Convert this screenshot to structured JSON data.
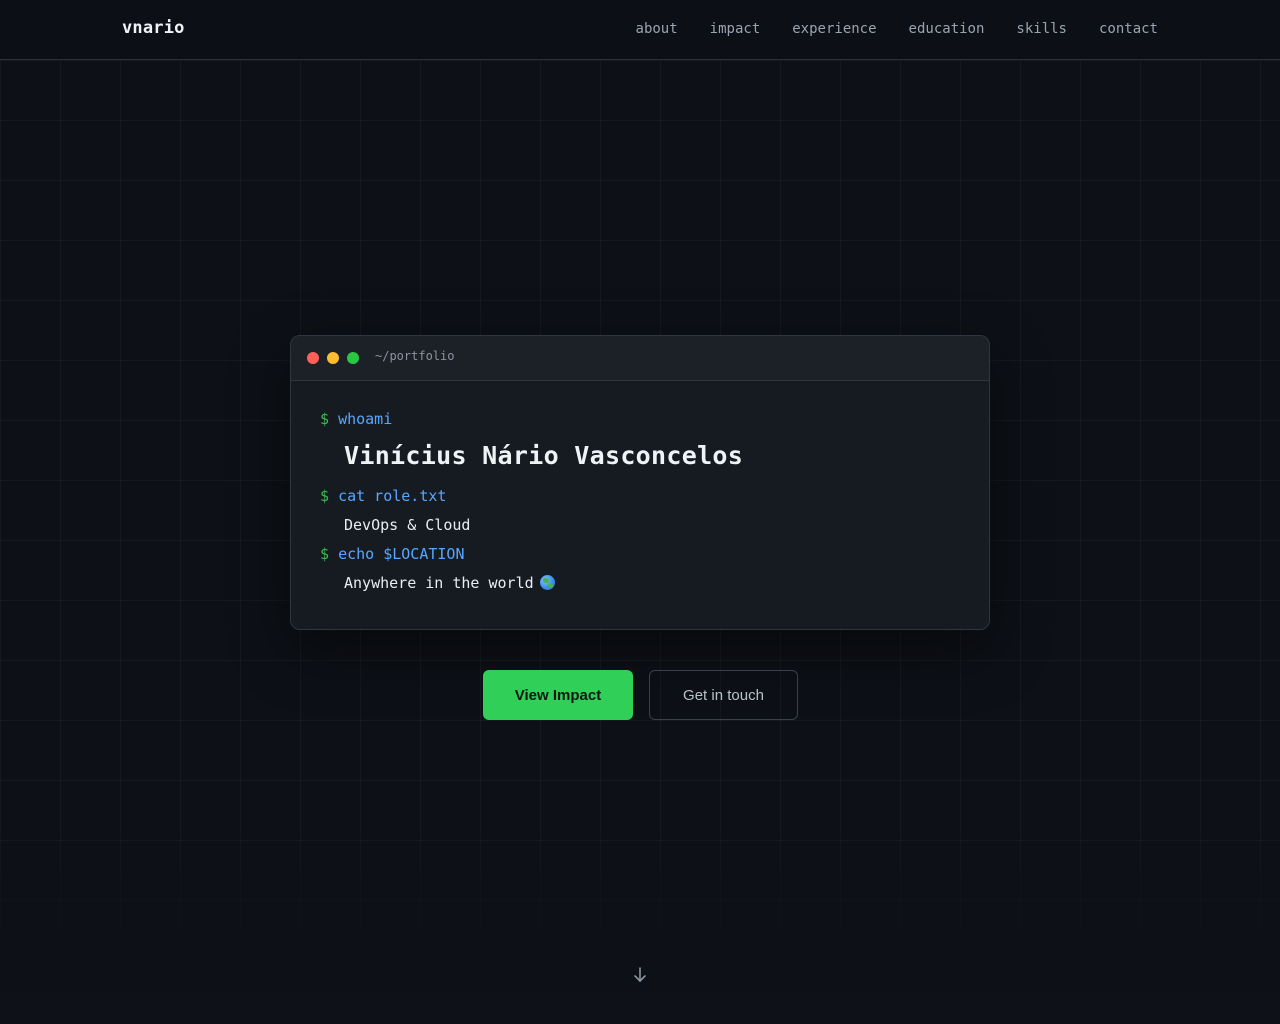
{
  "nav": {
    "brand": "vnario",
    "links": [
      {
        "label": "about"
      },
      {
        "label": "impact"
      },
      {
        "label": "experience"
      },
      {
        "label": "education"
      },
      {
        "label": "skills"
      },
      {
        "label": "contact"
      }
    ]
  },
  "terminal": {
    "path": "~/portfolio",
    "prompt": "$",
    "lines": [
      {
        "cmd": "whoami",
        "output": "Vinícius Nário Vasconcelos"
      },
      {
        "cmd": "cat role.txt",
        "output": "DevOps & Cloud"
      },
      {
        "cmd": "echo $LOCATION",
        "output": "Anywhere in the world"
      }
    ]
  },
  "buttons": {
    "primary": "View Impact",
    "secondary": "Get in touch"
  },
  "icons": {
    "location": "globe-icon",
    "scroll": "arrow-down-icon"
  },
  "colors": {
    "accent": "#2fcf58",
    "prompt": "#3fb950",
    "command": "#58a6ff",
    "background": "#0d1016"
  }
}
